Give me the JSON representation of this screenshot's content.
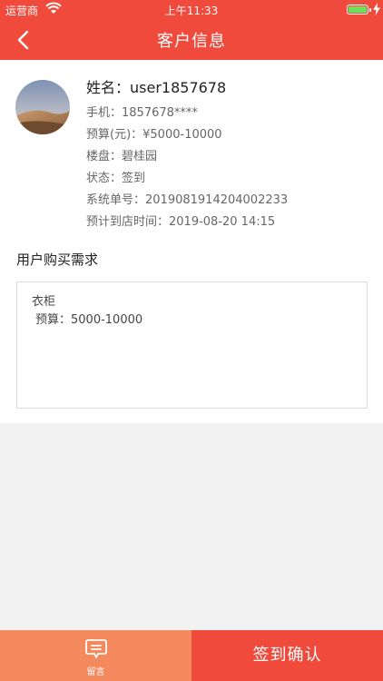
{
  "status": {
    "carrier": "运营商",
    "time": "上午11:33"
  },
  "nav": {
    "title": "客户信息"
  },
  "profile": {
    "name": "姓名：user1857678",
    "phone": "手机：1857678****",
    "budget": "预算(元)：¥5000-10000",
    "estate": "楼盘：碧桂园",
    "state": "状态：签到",
    "order_no": "系统单号：2019081914204002233",
    "arrival": "预计到店时间：2019-08-20 14:15"
  },
  "requirements": {
    "title": "用户购买需求",
    "item": "衣柜",
    "budget": "预算：5000-10000"
  },
  "bottom": {
    "message_label": "留言",
    "confirm_label": "签到确认"
  },
  "colors": {
    "primary": "#ef4a3b",
    "secondary": "#f3895c"
  },
  "icons": {
    "back": "chevron-left-icon",
    "message": "message-icon",
    "wifi": "wifi-icon",
    "battery": "battery-icon"
  }
}
